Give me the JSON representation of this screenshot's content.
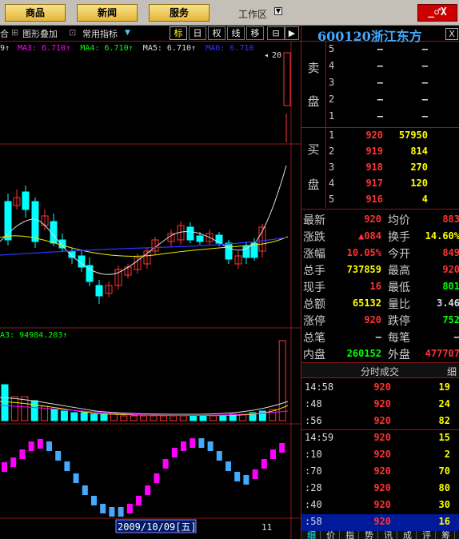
{
  "topbar": {
    "buttons": [
      "商品",
      "新闻",
      "服务"
    ],
    "workarea_label": "工作区",
    "window_controls": "_♂X"
  },
  "toolbar": {
    "overlay_label": "合",
    "chart_overlay": "图形叠加",
    "common_indicators": "常用指标",
    "buttons": [
      "标",
      "日",
      "权",
      "线",
      "移"
    ]
  },
  "ma_line": {
    "items": [
      {
        "label": "9↑",
        "color": "#ddd"
      },
      {
        "label": "MA3: 6.710↑",
        "color": "#f0f"
      },
      {
        "label": "MA4: 6.710↑",
        "color": "#0f0"
      },
      {
        "label": "MA5: 6.710↑",
        "color": "#ddd"
      },
      {
        "label": "MA6: 6.710",
        "color": "#33f"
      }
    ],
    "marker": "20"
  },
  "volume_label": "A3: 94984.203↑",
  "date_label": "2009/10/09[五]",
  "bottom_num": "11",
  "stock": {
    "code_name": "600120浙江东方",
    "close": "X"
  },
  "orderbook": {
    "sell_label": [
      "卖",
      "盘"
    ],
    "buy_label": [
      "买",
      "盘"
    ],
    "sell": [
      {
        "level": "5",
        "price": "–",
        "vol": "–"
      },
      {
        "level": "4",
        "price": "–",
        "vol": "–"
      },
      {
        "level": "3",
        "price": "–",
        "vol": "–"
      },
      {
        "level": "2",
        "price": "–",
        "vol": "–"
      },
      {
        "level": "1",
        "price": "–",
        "vol": "–"
      }
    ],
    "buy": [
      {
        "level": "1",
        "price": "920",
        "vol": "57950"
      },
      {
        "level": "2",
        "price": "919",
        "vol": "814"
      },
      {
        "level": "3",
        "price": "918",
        "vol": "270"
      },
      {
        "level": "4",
        "price": "917",
        "vol": "120"
      },
      {
        "level": "5",
        "price": "916",
        "vol": "4"
      }
    ]
  },
  "stats": [
    {
      "l1": "最新",
      "v1": "920",
      "c1": "red",
      "l2": "均价",
      "v2": "883",
      "c2": "red"
    },
    {
      "l1": "涨跌",
      "v1": "▲084",
      "c1": "red",
      "l2": "换手",
      "v2": "14.60%",
      "c2": "yel"
    },
    {
      "l1": "涨幅",
      "v1": "10.05%",
      "c1": "red",
      "l2": "今开",
      "v2": "849",
      "c2": "red"
    },
    {
      "l1": "总手",
      "v1": "737859",
      "c1": "yel",
      "l2": "最高",
      "v2": "920",
      "c2": "red"
    },
    {
      "l1": "现手",
      "v1": "16",
      "c1": "red",
      "l2": "最低",
      "v2": "801",
      "c2": "green"
    },
    {
      "l1": "总额",
      "v1": "65132",
      "c1": "yel",
      "l2": "量比",
      "v2": "3.46",
      "c2": "wht"
    },
    {
      "l1": "涨停",
      "v1": "920",
      "c1": "red",
      "l2": "跌停",
      "v2": "752",
      "c2": "green"
    },
    {
      "l1": "总笔",
      "v1": "–",
      "c1": "wht",
      "l2": "每笔",
      "v2": "–",
      "c2": "wht"
    },
    {
      "l1": "内盘",
      "v1": "260152",
      "c1": "green",
      "l2": "外盘",
      "v2": "477707",
      "c2": "red"
    }
  ],
  "ticks": {
    "title": "分时成交",
    "detail_tab": "细",
    "rows": [
      {
        "time": "14:58",
        "price": "920",
        "vol": "19"
      },
      {
        "time": ":48",
        "price": "920",
        "vol": "24"
      },
      {
        "time": ":56",
        "price": "920",
        "vol": "82"
      },
      {
        "time": "14:59",
        "price": "920",
        "vol": "15"
      },
      {
        "time": ":10",
        "price": "920",
        "vol": "2"
      },
      {
        "time": ":70",
        "price": "920",
        "vol": "70"
      },
      {
        "time": ":28",
        "price": "920",
        "vol": "80"
      },
      {
        "time": ":40",
        "price": "920",
        "vol": "30"
      },
      {
        "time": ":58",
        "price": "920",
        "vol": "16"
      }
    ]
  },
  "bottom_tabs": [
    "细",
    "价",
    "指",
    "势",
    "讯",
    "成",
    "评",
    "筹"
  ]
}
